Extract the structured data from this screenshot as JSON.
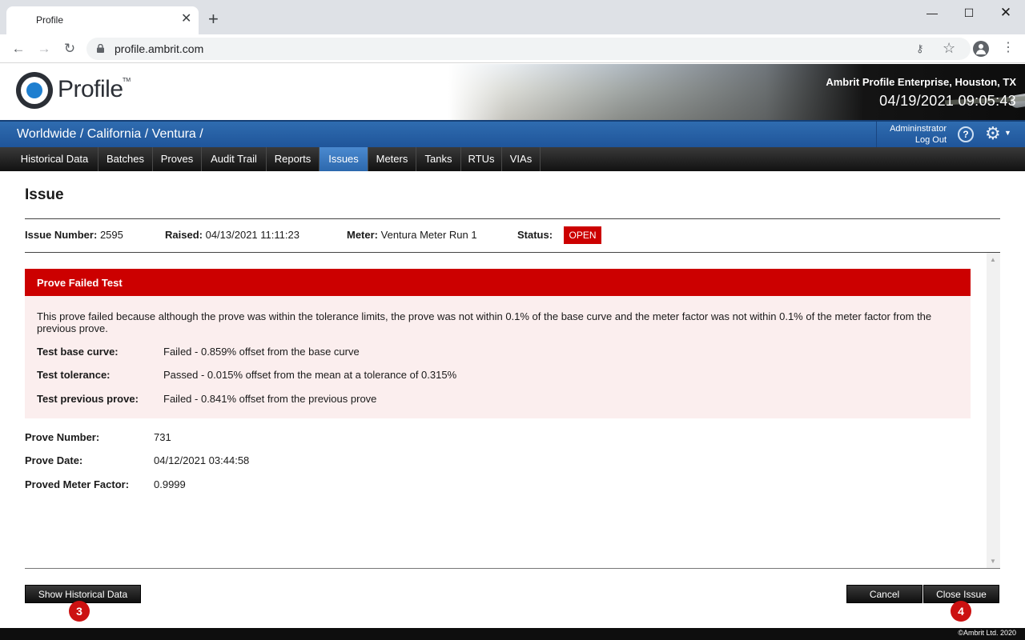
{
  "browser": {
    "tab_title": "Profile",
    "tab_close": "✕",
    "new_tab": "+",
    "window_minimize": "—",
    "window_maximize": "☐",
    "window_close": "✕",
    "url": "profile.ambrit.com",
    "icons": [
      "back-icon",
      "forward-icon",
      "reload-icon",
      "lock-icon",
      "key-icon",
      "star-icon",
      "account-icon",
      "menu-icon"
    ]
  },
  "header": {
    "logo_text": "Profile",
    "logo_tm": "TM",
    "company": "Ambrit Profile Enterprise, Houston, TX",
    "datetime": "04/19/2021 09:05:43"
  },
  "breadcrumb": "Worldwide / California / Ventura /",
  "user": {
    "name": "Admininstrator",
    "logout": "Log Out"
  },
  "menu": {
    "items": [
      {
        "label": "Historical Data"
      },
      {
        "label": "Batches"
      },
      {
        "label": "Proves"
      },
      {
        "label": "Audit Trail"
      },
      {
        "label": "Reports"
      },
      {
        "label": "Issues",
        "active": true
      },
      {
        "label": "Meters"
      },
      {
        "label": "Tanks"
      },
      {
        "label": "RTUs"
      },
      {
        "label": "VIAs"
      }
    ]
  },
  "issue": {
    "title": "Issue",
    "number_label": "Issue Number:",
    "number_value": "2595",
    "raised_label": "Raised:",
    "raised_value": "04/13/2021 11:11:23",
    "meter_label": "Meter:",
    "meter_value": "Ventura Meter Run 1",
    "status_label": "Status:",
    "status_value": "OPEN"
  },
  "alert": {
    "title": "Prove Failed Test",
    "description": "This prove failed because although the prove was within the tolerance limits, the prove was not within 0.1% of the base curve and the meter factor was not within 0.1% of the meter factor from the previous prove.",
    "tests": [
      {
        "label": "Test base curve:",
        "value": "Failed - 0.859% offset from the base curve"
      },
      {
        "label": "Test tolerance:",
        "value": "Passed - 0.015% offset from the mean at a tolerance of 0.315%"
      },
      {
        "label": "Test previous prove:",
        "value": "Failed - 0.841% offset from the previous prove"
      }
    ]
  },
  "prove": {
    "number_label": "Prove Number:",
    "number_value": "731",
    "date_label": "Prove Date:",
    "date_value": "04/12/2021 03:44:58",
    "factor_label": "Proved Meter Factor:",
    "factor_value": "0.9999"
  },
  "buttons": {
    "historical": "Show Historical Data",
    "cancel": "Cancel",
    "close_issue": "Close Issue"
  },
  "markers": {
    "historical": "3",
    "close_issue": "4"
  },
  "footer": "©Ambrit Ltd. 2020",
  "colors": {
    "accent_red": "#cc0000",
    "nav_blue": "#2f6cb0",
    "active_tab": "#2c68ad"
  }
}
